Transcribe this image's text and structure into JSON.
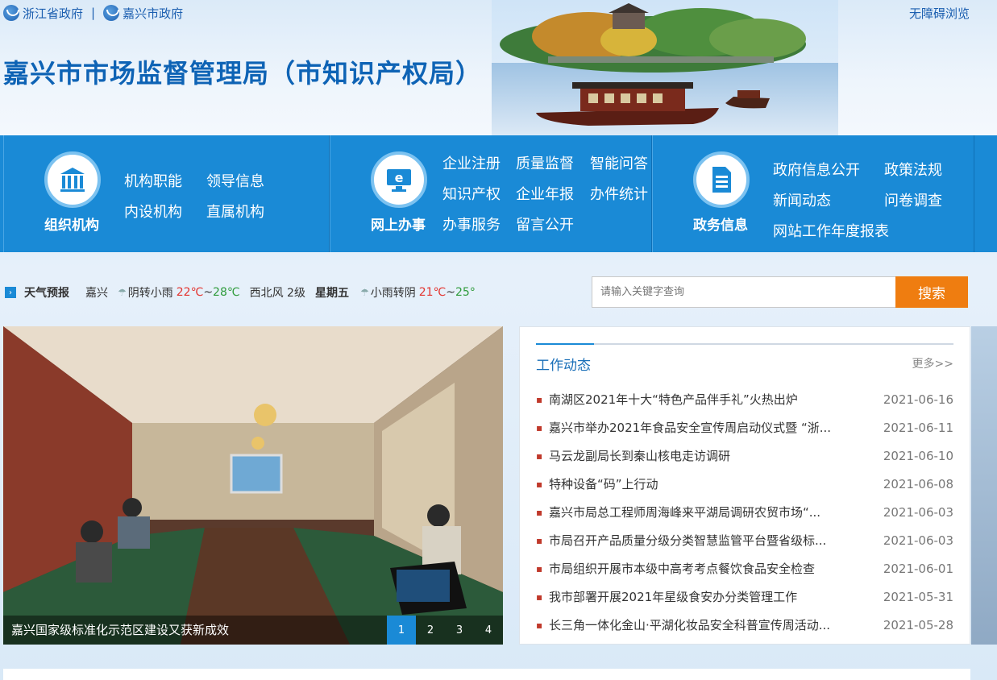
{
  "header": {
    "links": [
      {
        "label": "浙江省政府"
      },
      {
        "label": "嘉兴市政府"
      }
    ],
    "link_separator": "|",
    "accessible_label": "无障碍浏览",
    "site_title": "嘉兴市市场监督管理局（市知识产权局）"
  },
  "nav": {
    "groups": [
      {
        "name": "组织机构",
        "icon": "building-icon",
        "links": [
          "机构职能",
          "领导信息",
          "内设机构",
          "直属机构"
        ]
      },
      {
        "name": "网上办事",
        "icon": "online-service-icon",
        "links": [
          "企业注册",
          "质量监督",
          "智能问答",
          "知识产权",
          "企业年报",
          "办件统计",
          "办事服务",
          "留言公开"
        ]
      },
      {
        "name": "政务信息",
        "icon": "document-icon",
        "links": [
          "政府信息公开",
          "政策法规",
          "新闻动态",
          "问卷调查",
          "网站工作年度报表"
        ]
      }
    ]
  },
  "weather": {
    "label": "天气预报",
    "city": "嘉兴",
    "today": {
      "desc": "阴转小雨",
      "low": "22℃",
      "sep": "~",
      "high": "28℃"
    },
    "wind": "西北风 2级",
    "weekday": "星期五",
    "next": {
      "desc": "小雨转阴",
      "low": "21℃",
      "sep": "~",
      "high": "25°"
    }
  },
  "search": {
    "placeholder": "请输入关键字查询",
    "button": "搜索"
  },
  "carousel": {
    "caption": "嘉兴国家级标准化示范区建设又获新成效",
    "pages": [
      "1",
      "2",
      "3",
      "4"
    ],
    "active_page": "1"
  },
  "news": {
    "title": "工作动态",
    "more": "更多>>",
    "items": [
      {
        "title": "南湖区2021年十大“特色产品伴手礼”火热出炉",
        "date": "2021-06-16"
      },
      {
        "title": "嘉兴市举办2021年食品安全宣传周启动仪式暨 “浙...",
        "date": "2021-06-11"
      },
      {
        "title": "马云龙副局长到秦山核电走访调研",
        "date": "2021-06-10"
      },
      {
        "title": "特种设备“码”上行动",
        "date": "2021-06-08"
      },
      {
        "title": "嘉兴市局总工程师周海峰来平湖局调研农贸市场“...",
        "date": "2021-06-03"
      },
      {
        "title": "市局召开产品质量分级分类智慧监管平台暨省级标...",
        "date": "2021-06-03"
      },
      {
        "title": "市局组织开展市本级中高考考点餐饮食品安全检查",
        "date": "2021-06-01"
      },
      {
        "title": "我市部署开展2021年星级食安办分类管理工作",
        "date": "2021-05-31"
      },
      {
        "title": "长三角一体化金山·平湖化妆品安全科普宣传周活动...",
        "date": "2021-05-28"
      }
    ]
  },
  "colors": {
    "nav_blue": "#1a8ad6",
    "title_blue": "#0e63b5",
    "search_orange": "#ef7d10",
    "temp_red": "#e3342f",
    "temp_green": "#2e9b3b"
  }
}
